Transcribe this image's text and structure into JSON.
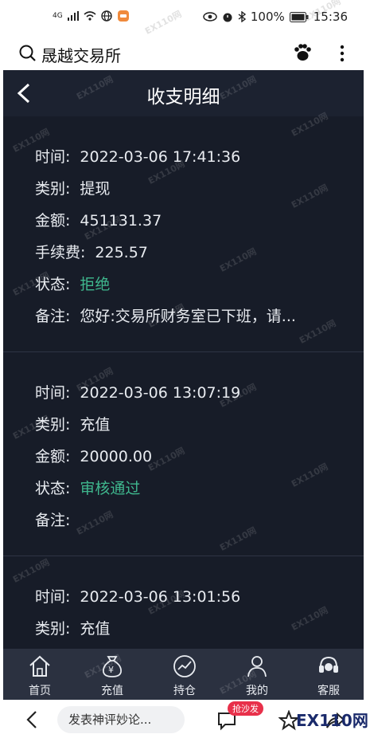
{
  "status_bar": {
    "network": "4G",
    "battery": "100%",
    "time": "15:36"
  },
  "app_bar": {
    "title": "晟越交易所"
  },
  "page": {
    "title": "收支明细"
  },
  "records": [
    {
      "rows": [
        {
          "label": "时间:",
          "value": "2022-03-06 17:41:36"
        },
        {
          "label": "类别:",
          "value": "提现"
        },
        {
          "label": "金额:",
          "value": "451131.37"
        },
        {
          "label": "手续费:",
          "value": "225.57"
        },
        {
          "label": "状态:",
          "value": "拒绝"
        },
        {
          "label": "备注:",
          "value": "您好:交易所财务室已下班，请..."
        }
      ]
    },
    {
      "rows": [
        {
          "label": "时间:",
          "value": "2022-03-06 13:07:19"
        },
        {
          "label": "类别:",
          "value": "充值"
        },
        {
          "label": "金额:",
          "value": "20000.00"
        },
        {
          "label": "状态:",
          "value": "审核通过"
        },
        {
          "label": "备注:",
          "value": ""
        }
      ]
    },
    {
      "rows": [
        {
          "label": "时间:",
          "value": "2022-03-06 13:01:56"
        },
        {
          "label": "类别:",
          "value": "充值"
        }
      ]
    }
  ],
  "tabs": [
    {
      "label": "首页",
      "icon": "home-icon"
    },
    {
      "label": "充值",
      "icon": "money-bag-icon"
    },
    {
      "label": "持仓",
      "icon": "chart-icon"
    },
    {
      "label": "我的",
      "icon": "user-icon"
    },
    {
      "label": "客服",
      "icon": "headset-icon"
    }
  ],
  "bottom_bar": {
    "comment_placeholder": "发表神评妙论...",
    "badge": "抢沙发",
    "logo": "EX110网"
  },
  "watermark": "EX110网",
  "colors": {
    "screen_bg": "#171c28",
    "tabbar_bg": "#2b3140",
    "status_green": "#3fb88e",
    "badge_red": "#e8304a"
  }
}
